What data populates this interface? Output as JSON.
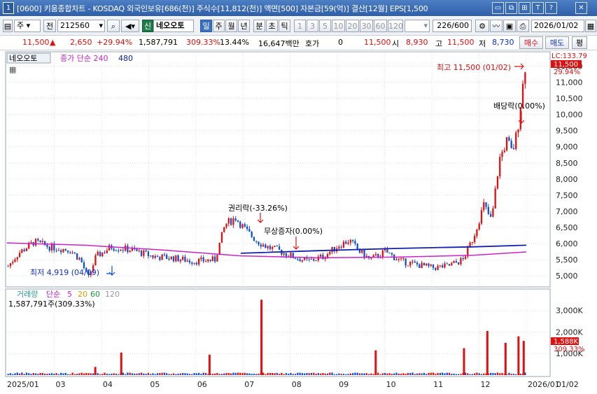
{
  "titlebar": {
    "window_number": "1",
    "title": "[0600] 키움종합차트 - KOSDAQ 외국인보유[686(천)] 주식수[11,812(천)] 액면[500] 자본금[59(억)] 결산[12월] EPS[1,500",
    "buttons": [
      "▭",
      "⧉",
      "⊞",
      "T",
      "?",
      "✕"
    ]
  },
  "toolbar": {
    "stock_type": "주",
    "period_mode": "전",
    "code": "212560",
    "market_tag": "신",
    "stock_name": "네오오토",
    "periods": [
      "일",
      "주",
      "월",
      "년",
      "분",
      "초",
      "틱"
    ],
    "active_period": "일",
    "intervals": [
      "1",
      "3",
      "5",
      "10",
      "20",
      "30",
      "60",
      "120"
    ],
    "count": "226/600",
    "date": "2026/01/02"
  },
  "quote": {
    "price": "11,500",
    "change": "2,650",
    "change_pct": "+29.94%",
    "volume": "1,587,791",
    "volume_ratio": "309.33%",
    "turnover": "13.44%",
    "amount": "16,647백만",
    "bid_label": "호가",
    "bid_value": "0",
    "last": "11,500",
    "open_label": "시",
    "open": "8,930",
    "high_label": "고",
    "high": "11,500",
    "low_label": "저",
    "low": "8,730",
    "buy_label": "매수",
    "sell_label": "매도",
    "avg_label": "평"
  },
  "legend": {
    "name": "네오오토",
    "ma_label": "종가 단순 240",
    "ma2": "480",
    "lc_label": "LC:133.79"
  },
  "annotations": {
    "high": "최고 11,500 (01/02)",
    "low": "최저 4,919 (04/09)",
    "rights": "권리락(-33.26%)",
    "bonus": "무상증자(0.00%)",
    "dividend": "배당락(0.00%)",
    "price_tag": "11,500",
    "pct_tag": "29.94%"
  },
  "volume_panel": {
    "title": "거래량",
    "ma_label": "단순",
    "ma_values": [
      "5",
      "20",
      "60",
      "120"
    ],
    "current": "1,587,791주(309.33%)",
    "tag_value": "1,588K",
    "tag_pct": "309.33%"
  },
  "colors": {
    "up": "#e01010",
    "down": "#1050d0",
    "ma240": "#cc22cc",
    "ma480": "#1020b0"
  },
  "chart_data": {
    "type": "candlestick",
    "price_axis": [
      "11,500",
      "11,000",
      "10,500",
      "10,000",
      "9,500",
      "9,000",
      "8,500",
      "8,000",
      "7,500",
      "7,000",
      "6,500",
      "6,000",
      "5,500",
      "5,000"
    ],
    "price_ticks": [
      11500,
      11000,
      10500,
      10000,
      9500,
      9000,
      8500,
      8000,
      7500,
      7000,
      6500,
      6000,
      5500,
      5000
    ],
    "ylim": [
      4700,
      11900
    ],
    "volume_axis": [
      "3,000K",
      "2,000K",
      "1,000K"
    ],
    "volume_ticks": [
      3000,
      2000,
      1000
    ],
    "volume_ylim": [
      0,
      3900
    ],
    "date_labels": [
      "2025/01",
      "03",
      "04",
      "05",
      "06",
      "07",
      "08",
      "09",
      "10",
      "11",
      "12",
      "2026/01",
      "01/02"
    ],
    "ma240_points": [
      [
        0,
        6020
      ],
      [
        0.15,
        5950
      ],
      [
        0.3,
        5800
      ],
      [
        0.45,
        5620
      ],
      [
        0.6,
        5560
      ],
      [
        0.75,
        5580
      ],
      [
        0.9,
        5640
      ],
      [
        1.0,
        5740
      ]
    ],
    "ma480_points": [
      [
        0.45,
        5700
      ],
      [
        0.6,
        5780
      ],
      [
        0.75,
        5850
      ],
      [
        0.9,
        5900
      ],
      [
        1.0,
        5950
      ]
    ],
    "price_path": [
      [
        0,
        5300
      ],
      [
        0.02,
        5700
      ],
      [
        0.05,
        6050
      ],
      [
        0.08,
        5900
      ],
      [
        0.12,
        5800
      ],
      [
        0.14,
        5500
      ],
      [
        0.155,
        4919
      ],
      [
        0.17,
        5600
      ],
      [
        0.2,
        5900
      ],
      [
        0.24,
        5800
      ],
      [
        0.28,
        5600
      ],
      [
        0.32,
        5550
      ],
      [
        0.36,
        5450
      ],
      [
        0.4,
        5500
      ],
      [
        0.42,
        6600
      ],
      [
        0.44,
        6800
      ],
      [
        0.46,
        6400
      ],
      [
        0.48,
        6100
      ],
      [
        0.5,
        5900
      ],
      [
        0.52,
        5800
      ],
      [
        0.55,
        5600
      ],
      [
        0.58,
        5450
      ],
      [
        0.61,
        5600
      ],
      [
        0.64,
        5950
      ],
      [
        0.66,
        6100
      ],
      [
        0.68,
        5750
      ],
      [
        0.7,
        5500
      ],
      [
        0.73,
        5750
      ],
      [
        0.76,
        5450
      ],
      [
        0.79,
        5350
      ],
      [
        0.82,
        5250
      ],
      [
        0.85,
        5300
      ],
      [
        0.88,
        5500
      ],
      [
        0.9,
        6200
      ],
      [
        0.92,
        7200
      ],
      [
        0.935,
        6700
      ],
      [
        0.95,
        8600
      ],
      [
        0.965,
        9200
      ],
      [
        0.975,
        8800
      ],
      [
        0.985,
        9500
      ],
      [
        1.0,
        11500
      ]
    ],
    "volume_spikes": [
      [
        0.22,
        1050
      ],
      [
        0.17,
        380
      ],
      [
        0.39,
        950
      ],
      [
        0.49,
        3500
      ],
      [
        0.71,
        1150
      ],
      [
        0.88,
        1250
      ],
      [
        0.925,
        2050
      ],
      [
        0.96,
        1500
      ],
      [
        0.985,
        1800
      ],
      [
        0.995,
        1588
      ]
    ]
  }
}
